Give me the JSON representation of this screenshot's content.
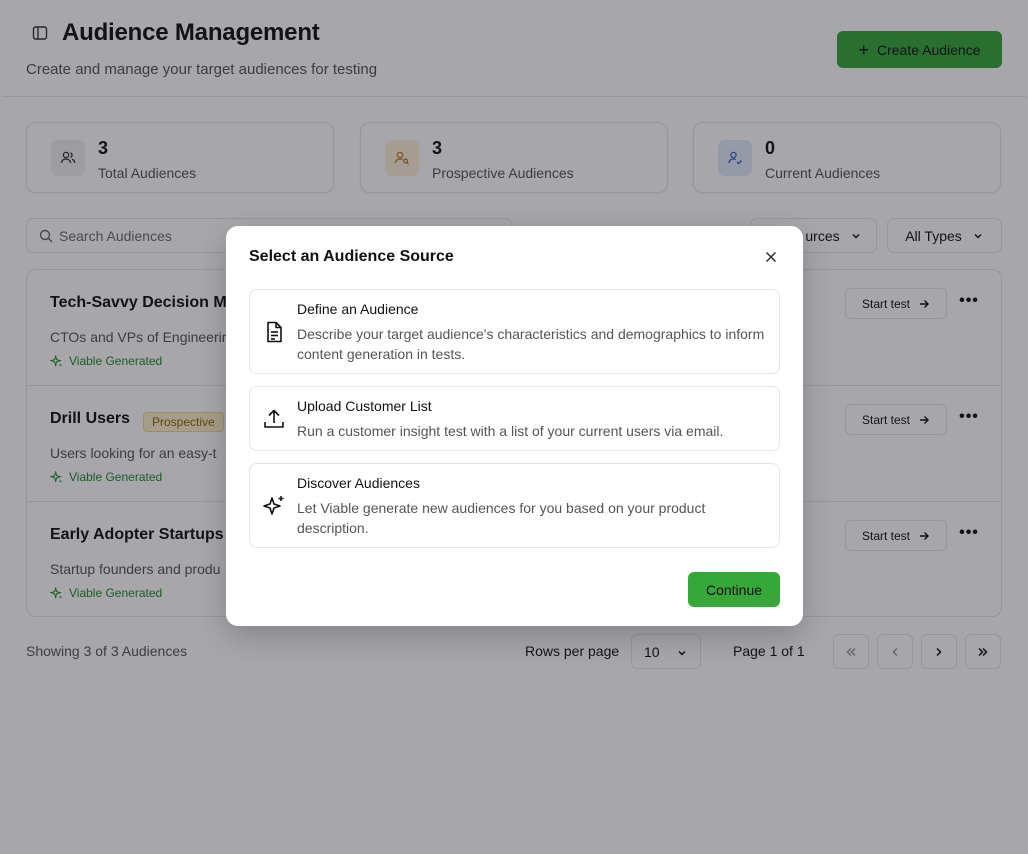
{
  "header": {
    "title": "Audience Management",
    "subtitle": "Create and manage your target audiences for testing",
    "create_button": "Create Audience"
  },
  "stats": [
    {
      "value": "3",
      "label": "Total Audiences"
    },
    {
      "value": "3",
      "label": "Prospective Audiences"
    },
    {
      "value": "0",
      "label": "Current Audiences"
    }
  ],
  "search": {
    "placeholder": "Search Audiences"
  },
  "filters": {
    "sources": "urces",
    "types": "All Types"
  },
  "rows": [
    {
      "name": "Tech-Savvy Decision M",
      "badge": "",
      "description": "CTOs and VPs of Engineerir",
      "source": "Viable Generated",
      "action": "Start test"
    },
    {
      "name": "Drill Users",
      "badge": "Prospective",
      "description": "Users looking for an easy-t",
      "source": "Viable Generated",
      "action": "Start test"
    },
    {
      "name": "Early Adopter Startups",
      "badge": "",
      "description": "Startup founders and produ",
      "source": "Viable Generated",
      "action": "Start test"
    }
  ],
  "pagination": {
    "showing": "Showing 3 of 3 Audiences",
    "rows_label": "Rows per page",
    "rows_value": "10",
    "page_info": "Page 1 of 1"
  },
  "modal": {
    "title": "Select an Audience Source",
    "options": [
      {
        "title": "Define an Audience",
        "description": "Describe your target audience's characteristics and demographics to inform content generation in tests."
      },
      {
        "title": "Upload Customer List",
        "description": "Run a customer insight test with a list of your current users via email."
      },
      {
        "title": "Discover Audiences",
        "description": "Let Viable generate new audiences for you based on your product description."
      }
    ],
    "continue": "Continue"
  },
  "icons": {
    "sidebar_toggle": "sidebar-toggle-icon",
    "option_icons": [
      "document-icon",
      "upload-icon",
      "sparkle-icon"
    ]
  },
  "colors": {
    "accent_green": "#36a839",
    "viable_green": "#248a2a",
    "prospective_badge_bg": "#fdf0c8"
  }
}
